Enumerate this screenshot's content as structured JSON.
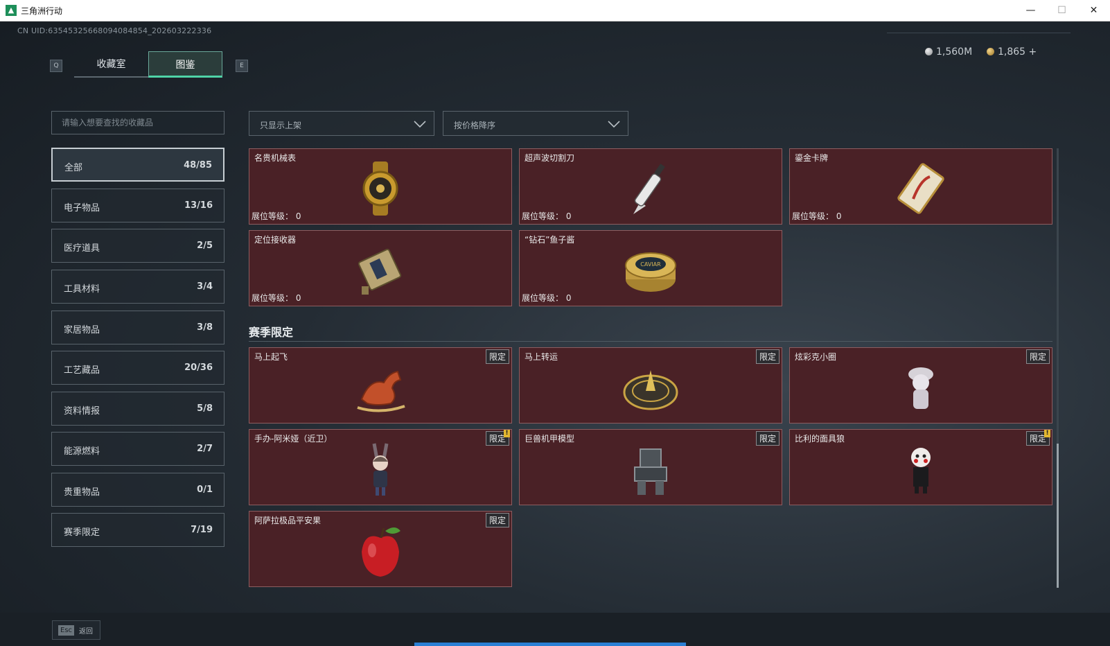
{
  "window": {
    "title": "三角洲行动",
    "minimize": "—",
    "maximize": "☐",
    "close": "✕"
  },
  "uid": "CN UID:6354532566809408485​4_202603222336",
  "keys": {
    "prev_tab": "Q",
    "next_tab": "E"
  },
  "tabs": [
    {
      "label": "收藏室",
      "active": false
    },
    {
      "label": "图鉴",
      "active": true
    }
  ],
  "currency": {
    "silver": "1,560M",
    "gold": "1,865 +"
  },
  "search": {
    "placeholder": "请输入想要查找的收藏品"
  },
  "categories": [
    {
      "label": "全部",
      "count": "48/85",
      "active": true
    },
    {
      "label": "电子物品",
      "count": "13/16"
    },
    {
      "label": "医疗道具",
      "count": "2/5"
    },
    {
      "label": "工具材料",
      "count": "3/4"
    },
    {
      "label": "家居物品",
      "count": "3/8"
    },
    {
      "label": "工艺藏品",
      "count": "20/36"
    },
    {
      "label": "资料情报",
      "count": "5/8"
    },
    {
      "label": "能源燃料",
      "count": "2/7"
    },
    {
      "label": "贵重物品",
      "count": "0/1"
    },
    {
      "label": "赛季限定",
      "count": "7/19"
    }
  ],
  "filters": {
    "shelf": "只显示上架",
    "sort": "按价格降序"
  },
  "items": [
    {
      "name": "名贵机械表",
      "level": "展位等级： 0",
      "icon": "watch-icon"
    },
    {
      "name": "超声波切割刀",
      "level": "展位等级： 0",
      "icon": "knife-icon"
    },
    {
      "name": "鎏金卡牌",
      "level": "展位等级： 0",
      "icon": "card-icon"
    },
    {
      "name": "定位接收器",
      "level": "展位等级： 0",
      "icon": "receiver-icon"
    },
    {
      "name": "“钻石”鱼子酱",
      "level": "展位等级： 0",
      "icon": "caviar-icon",
      "caviar_text": "CAVIAR"
    }
  ],
  "season_section": {
    "title": "赛季限定"
  },
  "season_items": [
    {
      "name": "马上起飞",
      "badge": "限定",
      "icon": "horse-icon"
    },
    {
      "name": "马上转运",
      "badge": "限定",
      "icon": "compass-icon"
    },
    {
      "name": "炫彩克小圈",
      "badge": "限定",
      "icon": "figure-icon"
    },
    {
      "name": "手办-阿米娅（近卫）",
      "badge": "限定",
      "alert": "!",
      "icon": "amiya-figure-icon"
    },
    {
      "name": "巨兽机甲模型",
      "badge": "限定",
      "icon": "mech-icon"
    },
    {
      "name": "比利的面具狼",
      "badge": "限定",
      "alert": "!",
      "icon": "puppet-icon"
    },
    {
      "name": "阿萨拉极品平安果",
      "badge": "限定",
      "icon": "apple-icon"
    }
  ],
  "footer": {
    "esc_key": "Esc",
    "esc_label": "返回"
  },
  "colors": {
    "card_bg": "#4a2126",
    "card_border": "#8d5d60",
    "tab_active": "#4fd3a7",
    "progress": "#2a7fd4"
  }
}
